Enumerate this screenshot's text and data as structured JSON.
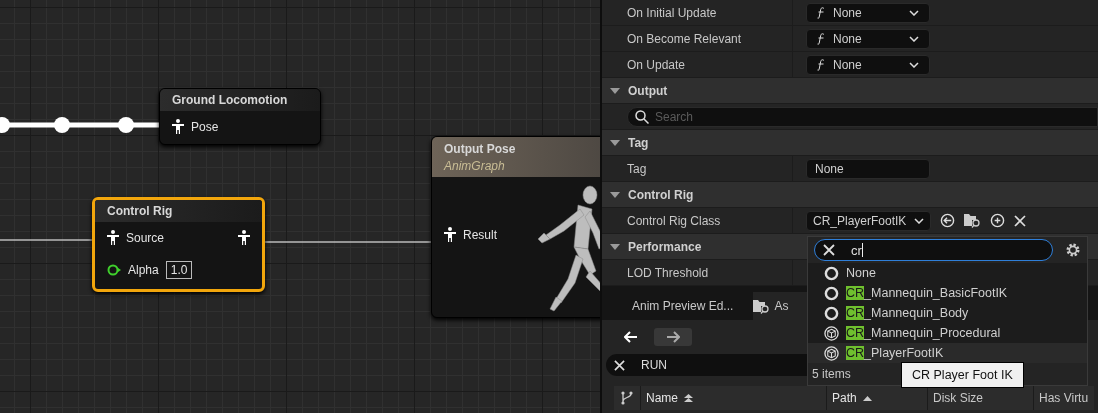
{
  "graph": {
    "nodes": [
      {
        "kind": "pose",
        "title": "Ground Locomotion",
        "selected": false,
        "pins": [
          {
            "kind": "pose",
            "label": "Pose"
          }
        ]
      },
      {
        "kind": "rig",
        "title": "Control Rig",
        "selected": true,
        "pins": [
          {
            "kind": "pose",
            "label": "Source"
          },
          {
            "kind": "float",
            "label": "Alpha",
            "value": "1.0"
          }
        ]
      },
      {
        "kind": "output",
        "title": "Output Pose",
        "subtitle": "AnimGraph",
        "selected": false,
        "pins": [
          {
            "kind": "pose",
            "label": "Result"
          }
        ]
      }
    ]
  },
  "details": {
    "rows": [
      {
        "kind": "function",
        "label": "On Initial Update",
        "value": "None"
      },
      {
        "kind": "function",
        "label": "On Become Relevant",
        "value": "None"
      },
      {
        "kind": "function",
        "label": "On Update",
        "value": "None"
      },
      {
        "kind": "section",
        "title": "Output",
        "expanded": true
      },
      {
        "kind": "search",
        "placeholder": "Search"
      },
      {
        "kind": "section",
        "title": "Tag",
        "expanded": true
      },
      {
        "kind": "text",
        "label": "Tag",
        "value": "None"
      },
      {
        "kind": "section",
        "title": "Control Rig",
        "expanded": true
      },
      {
        "kind": "class",
        "label": "Control Rig Class",
        "value": "CR_PlayerFootIK"
      },
      {
        "kind": "section",
        "title": "Performance",
        "expanded": true
      },
      {
        "kind": "plain",
        "label": "LOD Threshold"
      }
    ]
  },
  "browser": {
    "tabs": [
      {
        "label": "Anim Preview Ed...",
        "selected": false,
        "kind": "plain"
      },
      {
        "label": "As",
        "selected": true,
        "kind": "folder"
      }
    ],
    "search_value": "RUN",
    "columns": [
      {
        "label": "Name",
        "sorted": true,
        "double_sort": true
      },
      {
        "label": "Path",
        "sorted": true,
        "double_sort": false
      },
      {
        "label": "Disk Size",
        "sorted": false,
        "double_sort": false
      },
      {
        "label": "Has Virtu",
        "sorted": false,
        "double_sort": false
      }
    ]
  },
  "picker": {
    "query": "cr",
    "items": [
      {
        "kind": "ring",
        "label": "None",
        "selected": false
      },
      {
        "kind": "ring",
        "match": "CR",
        "rest": "_Mannequin_BasicFootIK",
        "selected": false
      },
      {
        "kind": "ring",
        "match": "CR",
        "rest": "_Mannequin_Body",
        "selected": false
      },
      {
        "kind": "cube",
        "match": "CR",
        "rest": "_Mannequin_Procedural",
        "selected": false
      },
      {
        "kind": "cube",
        "match": "CR",
        "rest": "_PlayerFootIK",
        "selected": true
      }
    ],
    "count": "5 items"
  },
  "tooltip": {
    "text": "CR Player Foot IK"
  }
}
